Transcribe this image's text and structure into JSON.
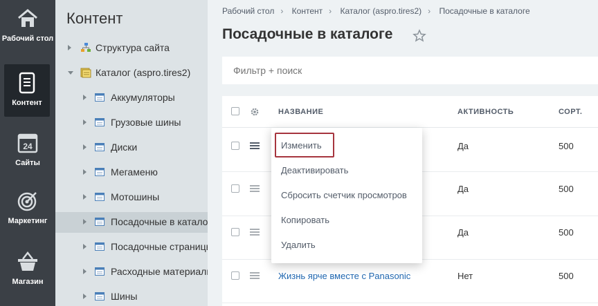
{
  "rail": {
    "items": [
      {
        "label": "Рабочий стол",
        "icon": "home-icon"
      },
      {
        "label": "Контент",
        "icon": "document-icon",
        "active": true
      },
      {
        "label": "Сайты",
        "icon": "calendar-icon"
      },
      {
        "label": "Маркетинг",
        "icon": "target-icon"
      },
      {
        "label": "Магазин",
        "icon": "basket-icon"
      }
    ]
  },
  "tree": {
    "title": "Контент",
    "items": [
      {
        "label": "Структура сайта"
      },
      {
        "label": "Каталог (aspro.tires2)"
      },
      {
        "label": "Аккумуляторы"
      },
      {
        "label": "Грузовые шины"
      },
      {
        "label": "Диски"
      },
      {
        "label": "Мегаменю"
      },
      {
        "label": "Мотошины"
      },
      {
        "label": "Посадочные в каталоге",
        "selected": true
      },
      {
        "label": "Посадочные страницы"
      },
      {
        "label": "Расходные материалы"
      },
      {
        "label": "Шины"
      }
    ]
  },
  "breadcrumb": [
    "Рабочий стол",
    "Контент",
    "Каталог (aspro.tires2)",
    "Посадочные в каталоге"
  ],
  "page_title": "Посадочные в каталоге",
  "filter": {
    "placeholder": "Фильтр + поиск"
  },
  "grid": {
    "columns": [
      "НАЗВАНИЕ",
      "АКТИВНОСТЬ",
      "СОРТ."
    ],
    "rows": [
      {
        "name": "",
        "active": "Да",
        "sort": "500"
      },
      {
        "name": "",
        "active": "Да",
        "sort": "500"
      },
      {
        "name": "",
        "active": "Да",
        "sort": "500"
      },
      {
        "name": "Жизнь ярче вместе с Panasonic",
        "active": "Нет",
        "sort": "500"
      }
    ]
  },
  "context_menu": {
    "items": [
      "Изменить",
      "Деактивировать",
      "Сбросить счетчик просмотров",
      "Копировать",
      "Удалить"
    ]
  },
  "colors": {
    "rail_bg": "#3b4046",
    "tree_bg": "#dde3e6",
    "link": "#2067b0",
    "focus_border": "#a6343e"
  }
}
